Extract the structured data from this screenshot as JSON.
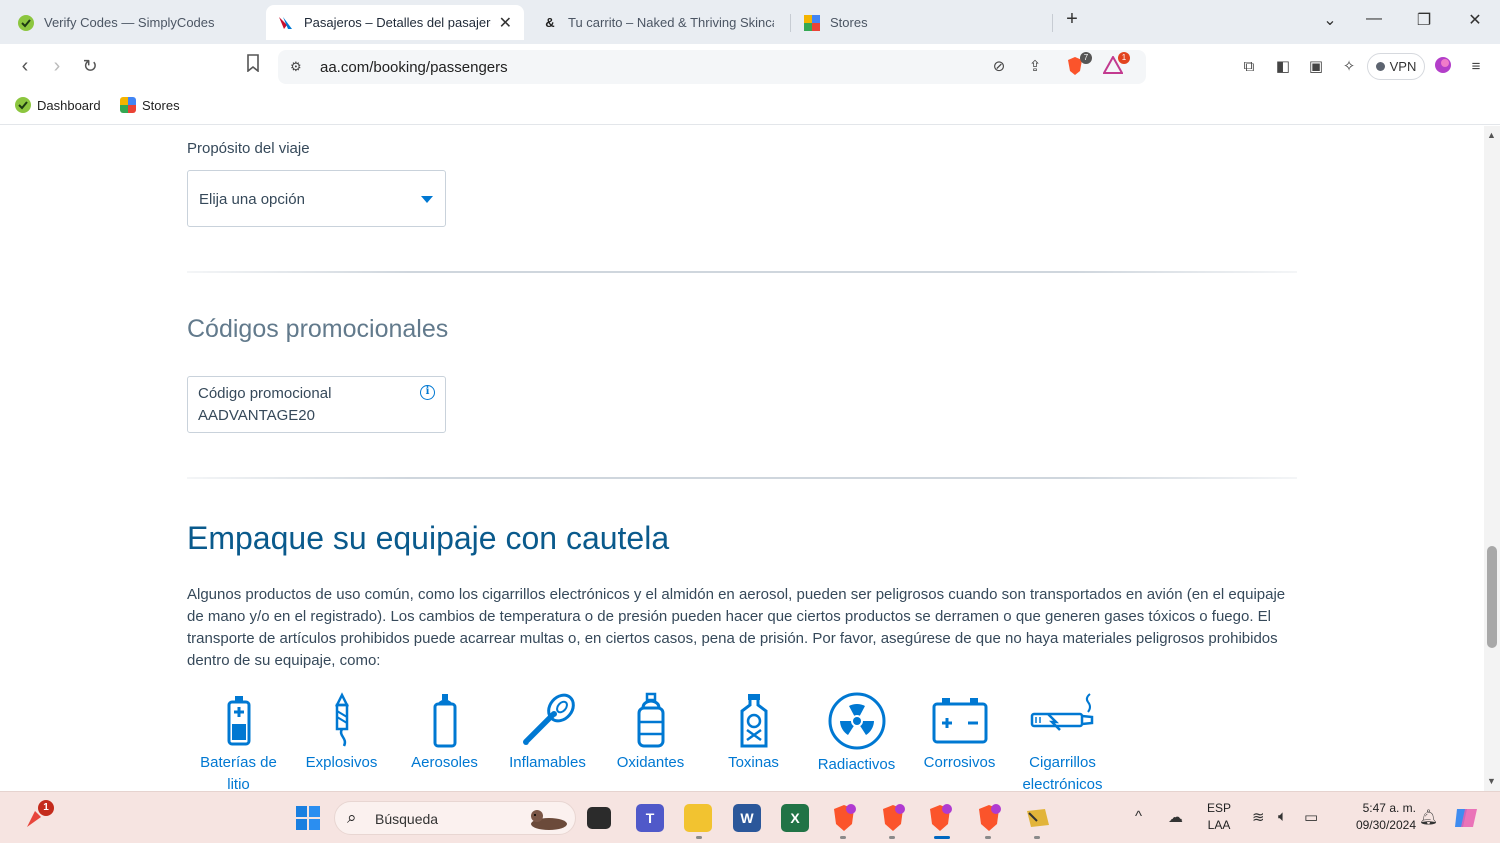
{
  "browser": {
    "tabs": [
      {
        "label": "Verify Codes — SimplyCodes",
        "active": false
      },
      {
        "label": "Pasajeros – Detalles del pasajero",
        "active": true
      },
      {
        "label": "Tu carrito – Naked & Thriving Skincare",
        "active": false
      },
      {
        "label": "Stores",
        "active": false
      }
    ],
    "url": "aa.com/booking/passengers",
    "vpn_label": "VPN",
    "shield_badge": "7",
    "alert_badge": "1",
    "bookmarks": [
      {
        "label": "Dashboard"
      },
      {
        "label": "Stores"
      }
    ]
  },
  "trip_purpose": {
    "label": "Propósito del viaje",
    "selected": "Elija una opción"
  },
  "promo": {
    "heading": "Códigos promocionales",
    "field_label": "Código promocional",
    "field_value": "AADVANTAGE20"
  },
  "packing": {
    "heading": "Empaque su equipaje con cautela",
    "body": "Algunos productos de uso común, como los cigarrillos electrónicos y el almidón en aerosol, pueden ser peligrosos cuando son transportados en avión (en el equipaje de mano y/o en el registrado). Los cambios de temperatura o de presión pueden hacer que ciertos productos se derramen o que generen gases tóxicos o fuego. El transporte de artículos prohibidos puede acarrear multas o, en ciertos casos, pena de prisión. Por favor, asegúrese de que no haya materiales peligrosos prohibidos dentro de su equipaje, como:",
    "hazards": [
      {
        "label": "Baterías de litio",
        "icon": "battery-icon"
      },
      {
        "label": "Explosivos",
        "icon": "firework-icon"
      },
      {
        "label": "Aerosoles",
        "icon": "aerosol-icon"
      },
      {
        "label": "Inflamables",
        "icon": "match-icon"
      },
      {
        "label": "Oxidantes",
        "icon": "bottle-icon"
      },
      {
        "label": "Toxinas",
        "icon": "poison-icon"
      },
      {
        "label": "Radiactivos",
        "icon": "radiation-icon"
      },
      {
        "label": "Corrosivos",
        "icon": "car-battery-icon"
      },
      {
        "label": "Cigarrillos electrónicos",
        "icon": "e-cigarette-icon"
      }
    ]
  },
  "taskbar": {
    "search_placeholder": "Búsqueda",
    "language": "ESP",
    "layout": "LAA",
    "time": "5:47 a. m.",
    "date": "09/30/2024",
    "notification_badge": "1"
  },
  "colors": {
    "accent": "#0078d2",
    "heading": "#0a5a8c",
    "text": "#36495a"
  }
}
